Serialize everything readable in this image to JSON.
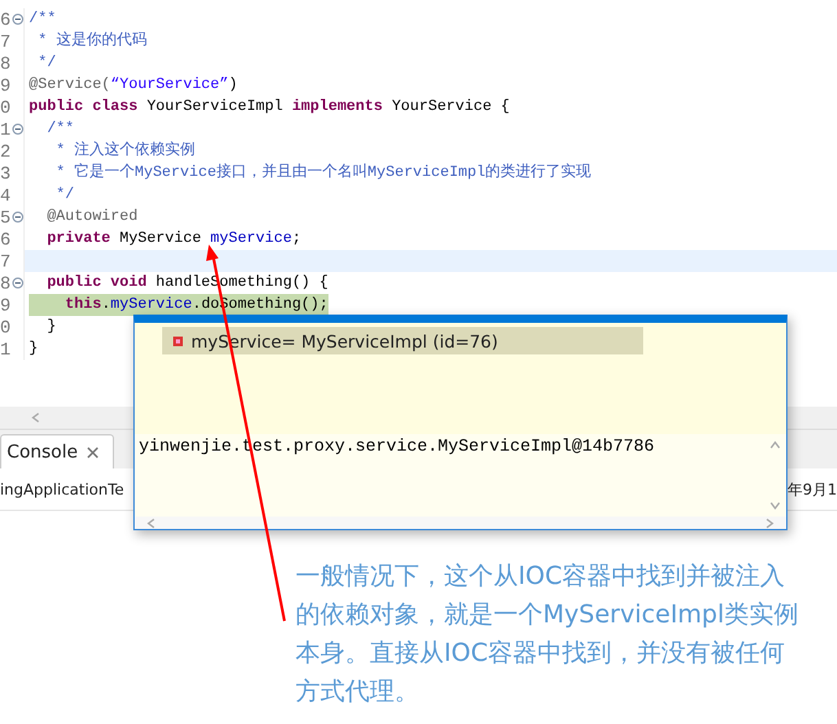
{
  "editor": {
    "lines": [
      {
        "number": "6",
        "foldable": true,
        "current": false,
        "debug": false,
        "tokens": [
          {
            "kind": "comment",
            "text": "/**"
          }
        ]
      },
      {
        "number": "7",
        "foldable": false,
        "current": false,
        "debug": false,
        "tokens": [
          {
            "kind": "comment",
            "text": " * 这是你的代码"
          }
        ]
      },
      {
        "number": "8",
        "foldable": false,
        "current": false,
        "debug": false,
        "tokens": [
          {
            "kind": "comment",
            "text": " */"
          }
        ]
      },
      {
        "number": "9",
        "foldable": false,
        "current": false,
        "debug": false,
        "tokens": [
          {
            "kind": "annotation",
            "text": "@Service("
          },
          {
            "kind": "string",
            "text": "“YourService”"
          },
          {
            "kind": "plain",
            "text": ")"
          }
        ]
      },
      {
        "number": "0",
        "foldable": false,
        "current": false,
        "debug": false,
        "tokens": [
          {
            "kind": "keyword",
            "text": "public class "
          },
          {
            "kind": "plain",
            "text": "YourServiceImpl "
          },
          {
            "kind": "keyword",
            "text": "implements "
          },
          {
            "kind": "plain",
            "text": "YourService {"
          }
        ]
      },
      {
        "number": "1",
        "foldable": true,
        "current": false,
        "debug": false,
        "tokens": [
          {
            "kind": "comment",
            "text": "  /**"
          }
        ]
      },
      {
        "number": "2",
        "foldable": false,
        "current": false,
        "debug": false,
        "tokens": [
          {
            "kind": "comment",
            "text": "   * 注入这个依赖实例"
          }
        ]
      },
      {
        "number": "3",
        "foldable": false,
        "current": false,
        "debug": false,
        "tokens": [
          {
            "kind": "comment",
            "text": "   * 它是一个MyService接口，并且由一个名叫MyServiceImpl的类进行了实现"
          }
        ]
      },
      {
        "number": "4",
        "foldable": false,
        "current": false,
        "debug": false,
        "tokens": [
          {
            "kind": "comment",
            "text": "   */"
          }
        ]
      },
      {
        "number": "5",
        "foldable": true,
        "current": false,
        "debug": false,
        "tokens": [
          {
            "kind": "annotation",
            "text": "  @Autowired"
          }
        ]
      },
      {
        "number": "6",
        "foldable": false,
        "current": false,
        "debug": false,
        "tokens": [
          {
            "kind": "keyword",
            "text": "  private "
          },
          {
            "kind": "plain",
            "text": "MyService "
          },
          {
            "kind": "field",
            "text": "myService"
          },
          {
            "kind": "plain",
            "text": ";"
          }
        ]
      },
      {
        "number": "7",
        "foldable": false,
        "current": true,
        "debug": false
      },
      {
        "number": "8",
        "foldable": true,
        "current": false,
        "debug": false,
        "tokens": [
          {
            "kind": "keyword",
            "text": "  public void "
          },
          {
            "kind": "plain",
            "text": "handleSomething() {"
          }
        ]
      },
      {
        "number": "9",
        "foldable": false,
        "current": false,
        "debug": true,
        "tokens": [
          {
            "kind": "keyword",
            "text": "    this"
          },
          {
            "kind": "plain",
            "text": "."
          },
          {
            "kind": "field",
            "text": "myService"
          },
          {
            "kind": "plain",
            "text": ".doSomething();"
          }
        ]
      },
      {
        "number": "0",
        "foldable": false,
        "current": false,
        "debug": false,
        "tokens": [
          {
            "kind": "plain",
            "text": "  }"
          }
        ]
      },
      {
        "number": "1",
        "foldable": false,
        "current": false,
        "debug": false,
        "tokens": [
          {
            "kind": "plain",
            "text": "}"
          }
        ]
      }
    ]
  },
  "console": {
    "tab": "Console",
    "left_text": "ingApplicationTe",
    "right_text": "年9月1"
  },
  "popup": {
    "variable": "myService= MyServiceImpl  (id=76)",
    "value": "yinwenjie.test.proxy.service.MyServiceImpl@14b7786"
  },
  "note": "一般情况下，这个从IOC容器中找到并被注入的依赖对象，就是一个MyServiceImpl类实例本身。直接从IOC容器中找到，并没有被任何方式代理。"
}
